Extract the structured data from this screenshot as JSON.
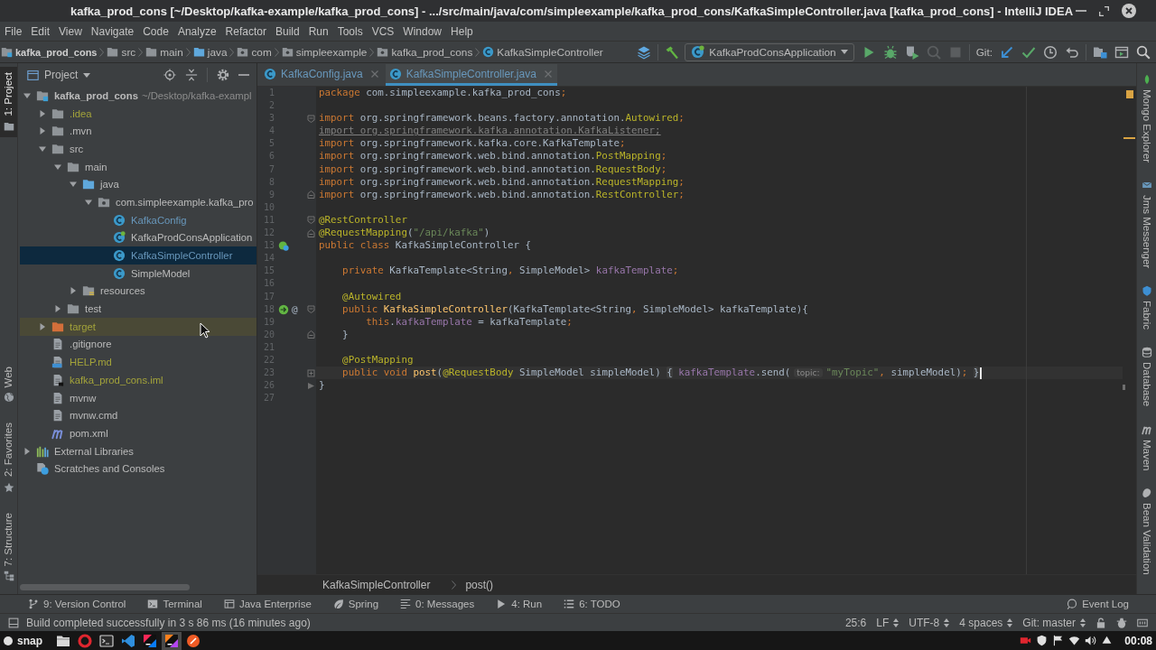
{
  "window": {
    "title": "kafka_prod_cons [~/Desktop/kafka-example/kafka_prod_cons] - .../src/main/java/com/simpleexample/kafka_prod_cons/KafkaSimpleController.java [kafka_prod_cons] - IntelliJ IDEA"
  },
  "menu": [
    "File",
    "Edit",
    "View",
    "Navigate",
    "Code",
    "Analyze",
    "Refactor",
    "Build",
    "Run",
    "Tools",
    "VCS",
    "Window",
    "Help"
  ],
  "navigation_bar": {
    "crumbs": [
      {
        "label": "kafka_prod_cons",
        "kind": "module"
      },
      {
        "label": "src",
        "kind": "folder"
      },
      {
        "label": "main",
        "kind": "folder"
      },
      {
        "label": "java",
        "kind": "source-folder"
      },
      {
        "label": "com",
        "kind": "package"
      },
      {
        "label": "simpleexample",
        "kind": "package"
      },
      {
        "label": "kafka_prod_cons",
        "kind": "package"
      },
      {
        "label": "KafkaSimpleController",
        "kind": "class"
      }
    ],
    "run_configuration": "KafkaProdConsApplication",
    "run_actions": [
      {
        "disabled": false
      },
      {
        "disabled": false
      },
      {
        "disabled": false
      },
      {
        "disabled": true
      },
      {
        "disabled": true
      }
    ],
    "vcs_label": "Git:"
  },
  "left_tool_strip": {
    "top": [
      {
        "label": "1: Project",
        "selected": true
      }
    ],
    "bottom": [
      {
        "label": "Web",
        "selected": false
      },
      {
        "label": "2: Favorites",
        "selected": false
      },
      {
        "label": "7: Structure",
        "selected": false
      }
    ]
  },
  "project_panel": {
    "title": "Project",
    "tree": [
      {
        "label": "kafka_prod_cons",
        "location": "~/Desktop/kafka-exampl",
        "kind": "module",
        "expanded": true,
        "selected": false,
        "hovered": false,
        "children": [
          {
            "label": ".idea",
            "kind": "folder",
            "color": "#a3a33a",
            "expanded": false,
            "selected": false,
            "hovered": false
          },
          {
            "label": ".mvn",
            "kind": "folder",
            "expanded": false,
            "selected": false,
            "hovered": false
          },
          {
            "label": "src",
            "kind": "folder",
            "expanded": true,
            "selected": false,
            "hovered": false,
            "children": [
              {
                "label": "main",
                "kind": "folder",
                "expanded": true,
                "selected": false,
                "hovered": false,
                "children": [
                  {
                    "label": "java",
                    "kind": "source-folder",
                    "expanded": true,
                    "selected": false,
                    "hovered": false,
                    "children": [
                      {
                        "label": "com.simpleexample.kafka_pro",
                        "kind": "package",
                        "expanded": true,
                        "selected": false,
                        "hovered": false,
                        "children": [
                          {
                            "label": "KafkaConfig",
                            "kind": "class",
                            "color": "#6897bb",
                            "selected": false,
                            "hovered": false
                          },
                          {
                            "label": "KafkaProdConsApplication",
                            "kind": "boot-class",
                            "selected": false,
                            "hovered": false
                          },
                          {
                            "label": "KafkaSimpleController",
                            "kind": "class",
                            "color": "#6897bb",
                            "selected": true,
                            "hovered": false
                          },
                          {
                            "label": "SimpleModel",
                            "kind": "class",
                            "selected": false,
                            "hovered": false
                          }
                        ]
                      }
                    ]
                  },
                  {
                    "label": "resources",
                    "kind": "resources-folder",
                    "expanded": false,
                    "selected": false,
                    "hovered": false
                  }
                ]
              },
              {
                "label": "test",
                "kind": "folder",
                "expanded": false,
                "selected": false,
                "hovered": false
              }
            ]
          },
          {
            "label": "target",
            "kind": "excluded-folder",
            "color": "#a3a33a",
            "expanded": false,
            "selected": false,
            "hovered": true
          },
          {
            "label": ".gitignore",
            "kind": "file",
            "selected": false,
            "hovered": false
          },
          {
            "label": "HELP.md",
            "kind": "markdown",
            "color": "#a3a33a",
            "selected": false,
            "hovered": false
          },
          {
            "label": "kafka_prod_cons.iml",
            "kind": "module-file",
            "color": "#a3a33a",
            "selected": false,
            "hovered": false
          },
          {
            "label": "mvnw",
            "kind": "file",
            "selected": false,
            "hovered": false
          },
          {
            "label": "mvnw.cmd",
            "kind": "file",
            "selected": false,
            "hovered": false
          },
          {
            "label": "pom.xml",
            "kind": "maven",
            "selected": false,
            "hovered": false
          }
        ]
      },
      {
        "label": "External Libraries",
        "kind": "libraries",
        "expanded": false,
        "selected": false,
        "hovered": false
      },
      {
        "label": "Scratches and Consoles",
        "kind": "scratches",
        "selected": false,
        "hovered": false
      }
    ]
  },
  "editor": {
    "tabs": [
      {
        "label": "KafkaConfig.java",
        "color": "#6897bb",
        "selected": false
      },
      {
        "label": "KafkaSimpleController.java",
        "color": "#6897bb",
        "selected": true
      }
    ],
    "warnings": true,
    "lines": [
      {
        "number": "1",
        "current": false,
        "tokens": [
          {
            "kind": "keyword",
            "text": "package"
          },
          {
            "kind": "plain",
            "text": " com.simpleexample.kafka_prod_cons"
          },
          {
            "kind": "punct",
            "text": ";"
          }
        ]
      },
      {
        "number": "2",
        "current": false
      },
      {
        "number": "3",
        "current": false,
        "fold": {
          "kind": "start"
        },
        "tokens": [
          {
            "kind": "keyword",
            "text": "import"
          },
          {
            "kind": "plain",
            "text": " org.springframework.beans.factory.annotation."
          },
          {
            "kind": "annotation",
            "text": "Autowired"
          },
          {
            "kind": "punct",
            "text": ";"
          }
        ]
      },
      {
        "number": "4",
        "current": false,
        "tokens": [
          {
            "kind": "unused",
            "text": "import org.springframework.kafka.annotation.KafkaListener;"
          }
        ]
      },
      {
        "number": "5",
        "current": false,
        "tokens": [
          {
            "kind": "keyword",
            "text": "import"
          },
          {
            "kind": "plain",
            "text": " org.springframework.kafka.core.KafkaTemplate"
          },
          {
            "kind": "punct",
            "text": ";"
          }
        ]
      },
      {
        "number": "6",
        "current": false,
        "tokens": [
          {
            "kind": "keyword",
            "text": "import"
          },
          {
            "kind": "plain",
            "text": " org.springframework.web.bind.annotation."
          },
          {
            "kind": "annotation",
            "text": "PostMapping"
          },
          {
            "kind": "punct",
            "text": ";"
          }
        ]
      },
      {
        "number": "7",
        "current": false,
        "tokens": [
          {
            "kind": "keyword",
            "text": "import"
          },
          {
            "kind": "plain",
            "text": " org.springframework.web.bind.annotation."
          },
          {
            "kind": "annotation",
            "text": "RequestBody"
          },
          {
            "kind": "punct",
            "text": ";"
          }
        ]
      },
      {
        "number": "8",
        "current": false,
        "tokens": [
          {
            "kind": "keyword",
            "text": "import"
          },
          {
            "kind": "plain",
            "text": " org.springframework.web.bind.annotation."
          },
          {
            "kind": "annotation",
            "text": "RequestMapping"
          },
          {
            "kind": "punct",
            "text": ";"
          }
        ]
      },
      {
        "number": "9",
        "current": false,
        "fold": {
          "kind": "end"
        },
        "tokens": [
          {
            "kind": "keyword",
            "text": "import"
          },
          {
            "kind": "plain",
            "text": " org.springframework.web.bind.annotation."
          },
          {
            "kind": "annotation",
            "text": "RestController"
          },
          {
            "kind": "punct",
            "text": ";"
          }
        ]
      },
      {
        "number": "10",
        "current": false
      },
      {
        "number": "11",
        "current": false,
        "fold": {
          "kind": "start"
        },
        "tokens": [
          {
            "kind": "annotation",
            "text": "@RestController"
          }
        ]
      },
      {
        "number": "12",
        "current": false,
        "fold": {
          "kind": "end"
        },
        "tokens": [
          {
            "kind": "annotation",
            "text": "@RequestMapping"
          },
          {
            "kind": "plain",
            "text": "("
          },
          {
            "kind": "string",
            "text": "\"/api/kafka\""
          },
          {
            "kind": "plain",
            "text": ")"
          }
        ]
      },
      {
        "number": "13",
        "current": false,
        "markers": [
          {
            "kind": "bean"
          }
        ],
        "tokens": [
          {
            "kind": "keyword",
            "text": "public class"
          },
          {
            "kind": "plain",
            "text": " KafkaSimpleController {"
          }
        ],
        "children": [
          {
            "number": "14",
            "current": false
          },
          {
            "number": "15",
            "current": false,
            "tokens": [
              {
                "kind": "keyword",
                "text": "private"
              },
              {
                "kind": "plain",
                "text": " KafkaTemplate<String"
              },
              {
                "kind": "punct",
                "text": ","
              },
              {
                "kind": "plain",
                "text": " SimpleModel> "
              },
              {
                "kind": "field",
                "text": "kafkaTemplate"
              },
              {
                "kind": "punct",
                "text": ";"
              }
            ]
          },
          {
            "number": "16",
            "current": false
          },
          {
            "number": "17",
            "current": false,
            "tokens": [
              {
                "kind": "annotation",
                "text": "@Autowired"
              }
            ]
          },
          {
            "number": "18",
            "current": false,
            "fold": {
              "kind": "start"
            },
            "markers": [
              {
                "kind": "injection"
              },
              {
                "kind": "symbol",
                "text": "@"
              }
            ],
            "tokens": [
              {
                "kind": "keyword",
                "text": "public"
              },
              {
                "kind": "method",
                "text": " KafkaSimpleController"
              },
              {
                "kind": "plain",
                "text": "(KafkaTemplate<String"
              },
              {
                "kind": "punct",
                "text": ","
              },
              {
                "kind": "plain",
                "text": " SimpleModel> kafkaTemplate){"
              }
            ],
            "children": [
              {
                "number": "19",
                "current": false,
                "tokens": [
                  {
                    "kind": "keyword",
                    "text": "this"
                  },
                  {
                    "kind": "plain",
                    "text": "."
                  },
                  {
                    "kind": "field",
                    "text": "kafkaTemplate"
                  },
                  {
                    "kind": "plain",
                    "text": " = kafkaTemplate"
                  },
                  {
                    "kind": "punct",
                    "text": ";"
                  }
                ]
              }
            ]
          },
          {
            "number": "20",
            "current": false,
            "fold": {
              "kind": "end"
            },
            "tokens": [
              {
                "kind": "plain",
                "text": "}"
              }
            ]
          },
          {
            "number": "21",
            "current": false
          },
          {
            "number": "22",
            "current": false,
            "tokens": [
              {
                "kind": "annotation",
                "text": "@PostMapping"
              }
            ]
          },
          {
            "number": "23",
            "current": true,
            "fold": {
              "kind": "collapsed"
            },
            "tokens": [
              {
                "kind": "keyword",
                "text": "public void"
              },
              {
                "kind": "method",
                "text": " post"
              },
              {
                "kind": "plain",
                "text": "("
              },
              {
                "kind": "annotation",
                "text": "@RequestBody"
              },
              {
                "kind": "plain",
                "text": " SimpleModel simpleModel) "
              },
              {
                "kind": "fold",
                "text": "{"
              },
              {
                "kind": "field",
                "text": " kafkaTemplate"
              },
              {
                "kind": "plain",
                "text": ".send("
              },
              {
                "kind": "hint",
                "text": "topic:"
              },
              {
                "kind": "string",
                "text": "\"myTopic\""
              },
              {
                "kind": "punct",
                "text": ","
              },
              {
                "kind": "plain",
                "text": " simpleModel)"
              },
              {
                "kind": "punct",
                "text": "; "
              },
              {
                "kind": "fold",
                "text": "}"
              }
            ]
          }
        ]
      },
      {
        "number": "26",
        "current": false,
        "fold": {
          "kind": "pointer"
        },
        "tokens": [
          {
            "kind": "plain",
            "text": "}"
          }
        ]
      },
      {
        "number": "27",
        "current": false
      }
    ],
    "breadcrumbs": [
      "KafkaSimpleController",
      "post()"
    ]
  },
  "right_tool_strip": [
    "Mongo Explorer",
    "Jms Messenger",
    "Fabric",
    "Database",
    "Maven",
    "Bean Validation"
  ],
  "bottom_bar": {
    "tool_windows": [
      "9: Version Control",
      "Terminal",
      "Java Enterprise",
      "Spring",
      "0: Messages",
      "4: Run",
      "6: TODO"
    ],
    "event_log": "Event Log"
  },
  "status_bar": {
    "message": "Build completed successfully in 3 s 86 ms (16 minutes ago)",
    "caret_position": "25:6",
    "line_separator": "LF",
    "encoding": "UTF-8",
    "indent": "4 spaces",
    "branch": "Git: master"
  },
  "taskbar": {
    "start": "snap",
    "apps": [
      {
        "active": false
      },
      {
        "active": false
      },
      {
        "active": false
      },
      {
        "active": false
      },
      {
        "active": false
      },
      {
        "active": true
      },
      {
        "active": false
      }
    ],
    "clock": "00:08"
  }
}
